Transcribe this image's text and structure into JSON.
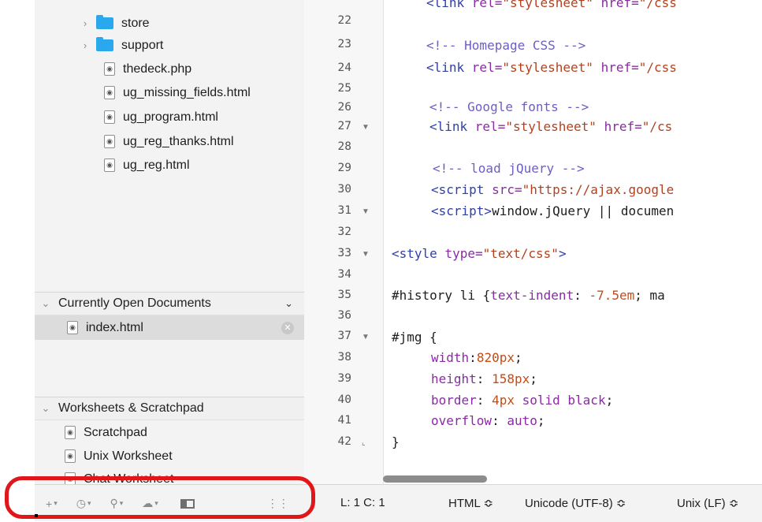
{
  "sidebar": {
    "tree": [
      {
        "type": "folder",
        "name": "store"
      },
      {
        "type": "folder",
        "name": "support"
      },
      {
        "type": "file",
        "name": "thedeck.php"
      },
      {
        "type": "file",
        "name": "ug_missing_fields.html"
      },
      {
        "type": "file",
        "name": "ug_program.html"
      },
      {
        "type": "file",
        "name": "ug_reg_thanks.html"
      },
      {
        "type": "file",
        "name": "ug_reg.html"
      }
    ],
    "open_docs_header": "Currently Open Documents",
    "open_docs": [
      {
        "name": "index.html"
      }
    ],
    "worksheets_header": "Worksheets & Scratchpad",
    "worksheets": [
      {
        "name": "Scratchpad"
      },
      {
        "name": "Unix Worksheet"
      },
      {
        "name": "Chat Worksheet"
      }
    ],
    "bottom_icons": [
      "add-icon",
      "clock-icon",
      "search-icon",
      "cloud-icon",
      "sidebar-toggle-icon",
      "resize-grip-icon"
    ]
  },
  "editor": {
    "line_numbers": [
      "22",
      "23",
      "24",
      "25",
      "26",
      "27",
      "28",
      "29",
      "30",
      "31",
      "32",
      "33",
      "34",
      "35",
      "36",
      "37",
      "38",
      "39",
      "40",
      "41",
      "42"
    ],
    "folded_lines": [
      "27",
      "31",
      "33",
      "37",
      "42"
    ]
  },
  "status_bar": {
    "position": "L: 1 C: 1",
    "language": "HTML ≎",
    "encoding": "Unicode (UTF-8) ≎",
    "line_endings": "Unix (LF) ≎"
  },
  "colors": {
    "highlight": "#e0161b",
    "folder": "#2aa8ee"
  }
}
